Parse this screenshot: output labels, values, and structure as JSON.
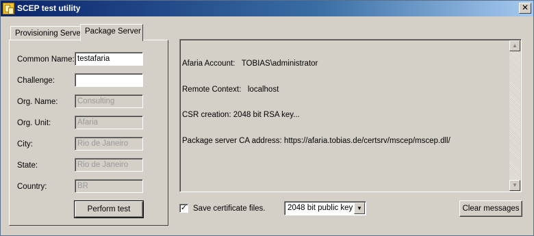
{
  "window": {
    "title": "SCEP test utility",
    "close_glyph": "✕"
  },
  "tabs": [
    {
      "label": "Provisioning Server",
      "active": false
    },
    {
      "label": "Package Server",
      "active": true
    }
  ],
  "form": {
    "common_name": {
      "label": "Common Name:",
      "value": "testafaria"
    },
    "challenge": {
      "label": "Challenge:",
      "value": ""
    },
    "org_name": {
      "label": "Org. Name:",
      "value": "Consulting"
    },
    "org_unit": {
      "label": "Org. Unit:",
      "value": "Afaria"
    },
    "city": {
      "label": "City:",
      "value": "Rio de Janeiro"
    },
    "state": {
      "label": "State:",
      "value": "Rio de Janeiro"
    },
    "country": {
      "label": "Country:",
      "value": "BR"
    },
    "perform_label": "Perform test"
  },
  "messages": [
    "Afaria Account:   TOBIAS\\administrator",
    "Remote Context:   localhost",
    "CSR creation: 2048 bit RSA key...",
    "Package server CA address: https://afaria.tobias.de/certsrv/mscep/mscep.dll/"
  ],
  "bottom": {
    "save_checked_glyph": "✓",
    "save_label": "Save certificate files.",
    "key_select_value": "2048 bit public key",
    "clear_label": "Clear messages"
  },
  "icons": {
    "app": "scep-app-icon",
    "scroll_up": "▲",
    "scroll_down": "▼",
    "dropdown": "▼"
  }
}
